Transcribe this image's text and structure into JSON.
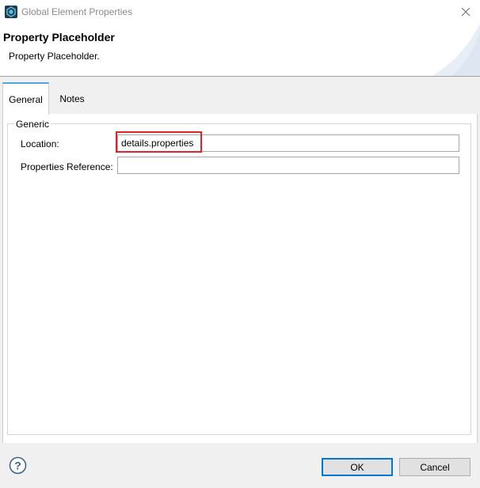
{
  "window": {
    "title": "Global Element Properties",
    "icon": "mule-studio-icon"
  },
  "banner": {
    "title": "Property Placeholder",
    "description": "Property Placeholder."
  },
  "tabs": [
    {
      "label": "General",
      "active": true
    },
    {
      "label": "Notes",
      "active": false
    }
  ],
  "general": {
    "group_title": "Generic",
    "fields": {
      "location": {
        "label": "Location:",
        "value": "details.properties"
      },
      "properties_reference": {
        "label": "Properties Reference:",
        "value": ""
      }
    }
  },
  "footer": {
    "help_icon": "question-circle-icon",
    "ok_label": "OK",
    "cancel_label": "Cancel"
  },
  "colors": {
    "highlight": "#d9262c",
    "active_tab_accent": "#4ea6dd",
    "default_button_border": "#0078d7"
  }
}
